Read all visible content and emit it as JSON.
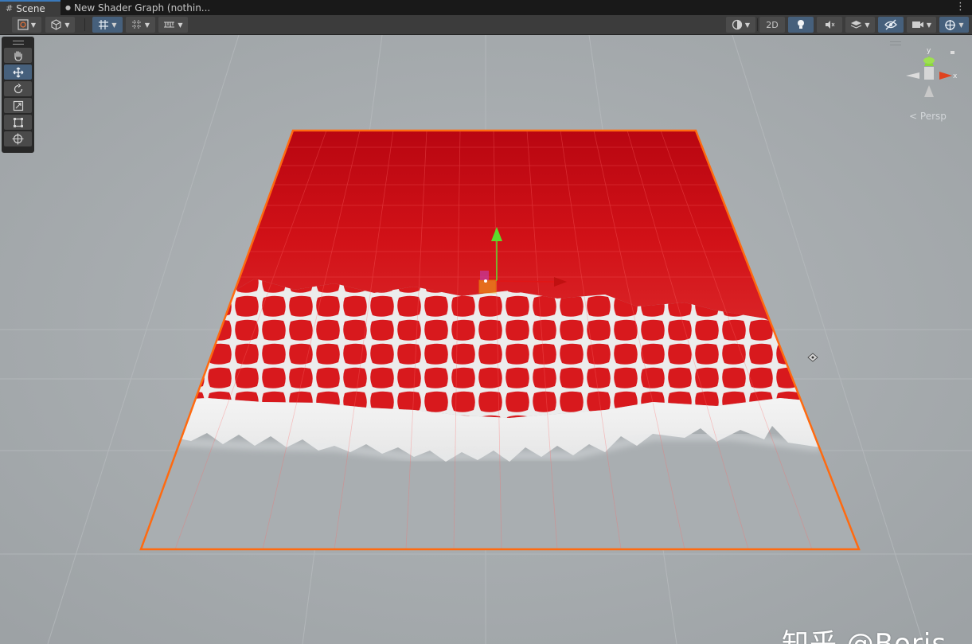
{
  "tabs": [
    {
      "label": "Scene",
      "icon": "grid-icon",
      "active": true
    },
    {
      "label": "New Shader Graph (nothin...",
      "icon": "shader-file-icon",
      "active": false
    }
  ],
  "toolbar": {
    "left": [
      {
        "name": "draw-mode-dropdown",
        "icon": "draw-mode-icon"
      },
      {
        "name": "render-mode-dropdown",
        "icon": "cube-icon"
      },
      {
        "name": "grid-toggle-dropdown",
        "icon": "grid-snap-icon",
        "active": true
      },
      {
        "name": "increment-snap-dropdown",
        "icon": "increment-snap-icon"
      },
      {
        "name": "ruler-dropdown",
        "icon": "ruler-icon"
      }
    ],
    "right": [
      {
        "name": "shading-dropdown",
        "icon": "sphere-icon"
      },
      {
        "name": "2d-toggle",
        "label": "2D"
      },
      {
        "name": "lighting-toggle",
        "icon": "bulb-icon",
        "active": true
      },
      {
        "name": "audio-toggle",
        "icon": "audio-icon"
      },
      {
        "name": "effects-dropdown",
        "icon": "effects-icon"
      },
      {
        "name": "visibility-toggle",
        "icon": "eye-slash-icon",
        "active": true
      },
      {
        "name": "camera-dropdown",
        "icon": "camera-icon"
      },
      {
        "name": "gizmos-dropdown",
        "icon": "gizmo-icon",
        "active": true
      }
    ]
  },
  "tools": [
    {
      "name": "hand-tool",
      "icon": "hand-icon"
    },
    {
      "name": "move-tool",
      "icon": "move-arrows-icon",
      "active": true
    },
    {
      "name": "rotate-tool",
      "icon": "rotate-icon"
    },
    {
      "name": "scale-tool",
      "icon": "scale-icon"
    },
    {
      "name": "rect-tool",
      "icon": "rect-icon"
    },
    {
      "name": "transform-tool",
      "icon": "transform-icon"
    }
  ],
  "orientation_gizmo": {
    "y_label": "y",
    "x_label": "x",
    "projection": "Persp"
  },
  "watermark": "知乎 @Boris",
  "colors": {
    "selection_outline": "#ff6a10",
    "dissolve_red": "#d40f16",
    "dissolve_white": "#f0f0f0",
    "background_gray": "#a7acaf",
    "move_axis_y": "#5cdc2c",
    "move_axis_x": "#e01616"
  }
}
